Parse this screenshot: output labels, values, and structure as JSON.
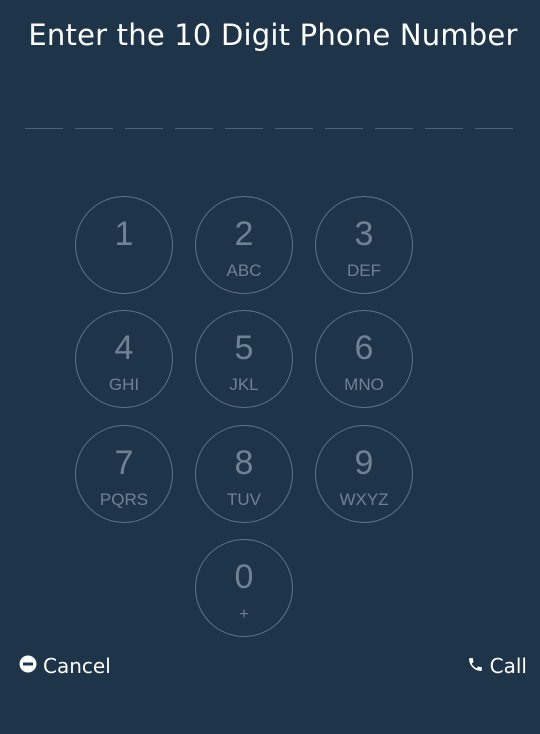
{
  "header": {
    "title": "Enter the 10 Digit Phone Number"
  },
  "phone_number": {
    "digits": [
      "",
      "",
      "",
      "",
      "",
      "",
      "",
      "",
      "",
      ""
    ]
  },
  "keypad": {
    "keys": [
      {
        "number": "1",
        "letters": ""
      },
      {
        "number": "2",
        "letters": "ABC"
      },
      {
        "number": "3",
        "letters": "DEF"
      },
      {
        "number": "4",
        "letters": "GHI"
      },
      {
        "number": "5",
        "letters": "JKL"
      },
      {
        "number": "6",
        "letters": "MNO"
      },
      {
        "number": "7",
        "letters": "PQRS"
      },
      {
        "number": "8",
        "letters": "TUV"
      },
      {
        "number": "9",
        "letters": "WXYZ"
      },
      {
        "number": "0",
        "letters": "+"
      }
    ]
  },
  "actions": {
    "cancel_label": "Cancel",
    "cancel_icon": "minus-circle-icon",
    "call_label": "Call",
    "call_icon": "phone-icon"
  },
  "colors": {
    "background": "#1e3448",
    "key_border": "#5f7386",
    "key_text": "#6e8294",
    "text": "#ffffff"
  }
}
